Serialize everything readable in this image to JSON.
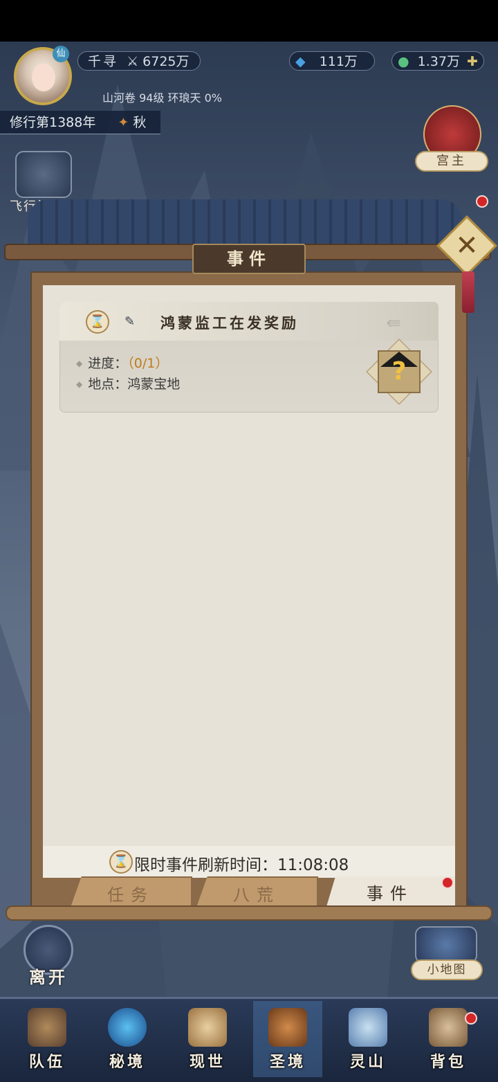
{
  "player": {
    "name": "千寻",
    "power": "6725万",
    "realm_info": "山河卷 94级 环琅天 0%",
    "year": "修行第1388年",
    "season": "秋",
    "badge": "仙"
  },
  "currencies": {
    "spirit_stones": "111万",
    "jade": "1.37万"
  },
  "side": {
    "palace_master": "宫主",
    "flying_artifact": "飞行法",
    "mini_map": "小地图",
    "leave": "离开"
  },
  "dialog": {
    "title": "事件",
    "event": {
      "name": "鸿蒙监工在发奖励",
      "progress_label": "进度：",
      "progress_value": "（0/1）",
      "location_label": "地点：",
      "location_value": "鸿蒙宝地"
    },
    "refresh_text": "限时事件刷新时间：11:08:08",
    "tabs": [
      "任务",
      "八荒",
      "事件"
    ]
  },
  "nav": {
    "items": [
      "队伍",
      "秘境",
      "现世",
      "圣境",
      "灵山",
      "背包"
    ],
    "active": "圣境"
  },
  "colors": {
    "accent_gold": "#c8a94a",
    "progress_orange": "#c07a1a",
    "notification_red": "#d42626"
  }
}
